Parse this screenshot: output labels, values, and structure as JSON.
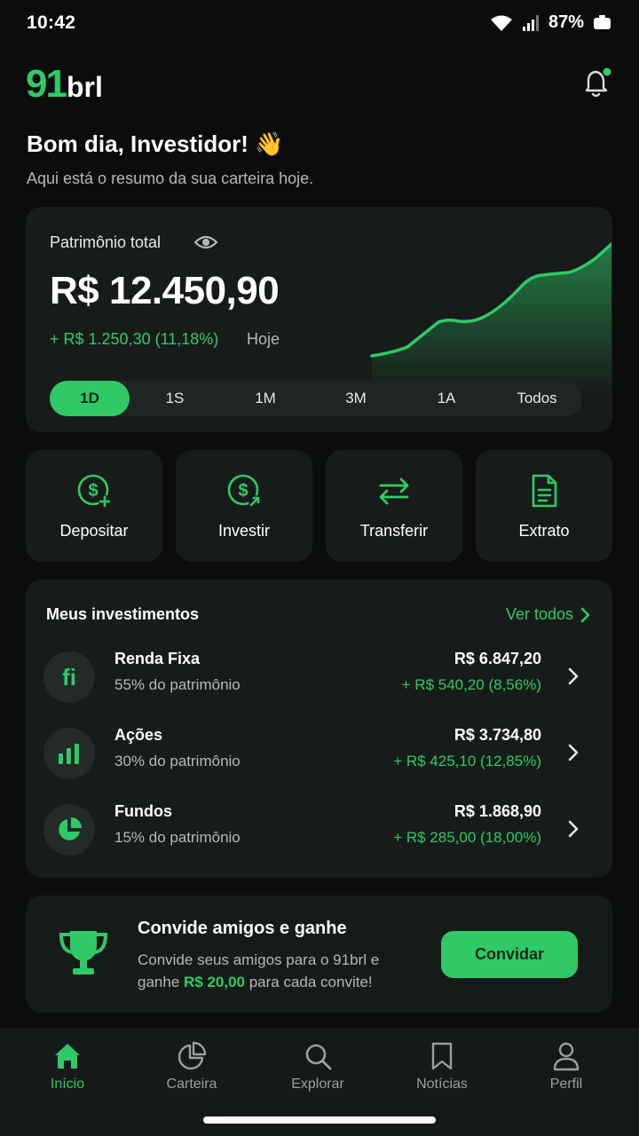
{
  "status_bar": {
    "time": "10:42",
    "battery": "87%"
  },
  "header": {
    "logo_number": "91",
    "logo_text": "brl"
  },
  "greeting": {
    "title": "Bom dia, Investidor! 👋",
    "subtitle": "Aqui está o resumo da sua carteira hoje."
  },
  "portfolio": {
    "label": "Patrimônio total",
    "value": "R$ 12.450,90",
    "change": "+ R$ 1.250,30 (11,18%)",
    "period": "Hoje",
    "ranges": [
      "1D",
      "1S",
      "1M",
      "3M",
      "1A",
      "Todos"
    ],
    "active_range": "1D"
  },
  "actions": [
    {
      "label": "Depositar",
      "icon": "deposit-icon"
    },
    {
      "label": "Investir",
      "icon": "invest-icon"
    },
    {
      "label": "Transferir",
      "icon": "transfer-icon"
    },
    {
      "label": "Extrato",
      "icon": "statement-icon"
    }
  ],
  "investments": {
    "title": "Meus investimentos",
    "see_all": "Ver todos",
    "items": [
      {
        "name": "Renda Fixa",
        "share": "55% do patrimônio",
        "value": "R$ 6.847,20",
        "gain": "+ R$ 540,20 (8,56%)",
        "icon": "fixed-income-icon",
        "icon_text": "fi"
      },
      {
        "name": "Ações",
        "share": "30% do patrimônio",
        "value": "R$ 3.734,80",
        "gain": "+ R$ 425,10 (12,85%)",
        "icon": "bar-chart-icon"
      },
      {
        "name": "Fundos",
        "share": "15% do patrimônio",
        "value": "R$ 1.868,90",
        "gain": "+ R$ 285,00 (18,00%)",
        "icon": "pie-chart-icon"
      }
    ]
  },
  "invite": {
    "title": "Convide amigos e ganhe",
    "body_before": "Convide seus amigos para o 91brl e ganhe ",
    "body_highlight": "R$ 20,00",
    "body_after": " para cada convite!",
    "button": "Convidar"
  },
  "nav": [
    {
      "label": "Início",
      "icon": "home-icon",
      "active": true
    },
    {
      "label": "Carteira",
      "icon": "wallet-chart-icon"
    },
    {
      "label": "Explorar",
      "icon": "search-icon"
    },
    {
      "label": "Notícias",
      "icon": "bookmark-icon"
    },
    {
      "label": "Perfil",
      "icon": "profile-icon"
    }
  ],
  "colors": {
    "accent": "#2fca67",
    "background": "#0b0d0c",
    "card": "#171c1a"
  }
}
